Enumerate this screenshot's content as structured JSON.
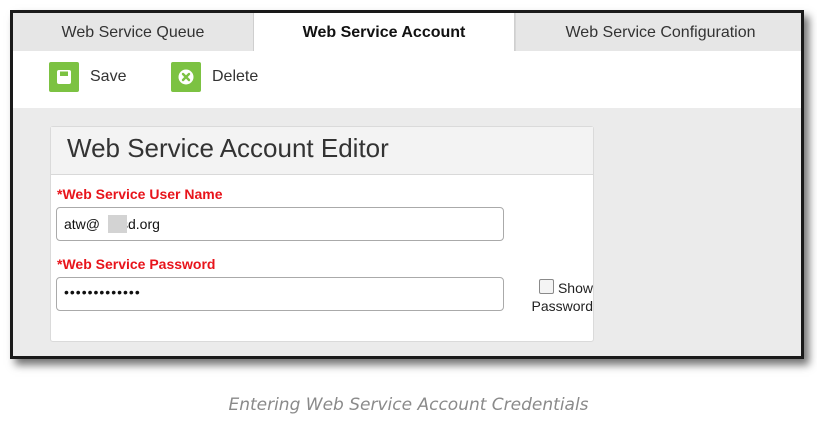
{
  "tabs": {
    "queue": "Web Service Queue",
    "account": "Web Service Account",
    "configuration": "Web Service Configuration"
  },
  "toolbar": {
    "save_label": "Save",
    "delete_label": "Delete",
    "accent_color": "#7cc242"
  },
  "editor": {
    "title": "Web Service Account Editor",
    "username_label": "*Web Service User Name",
    "username_value_prefix": "atw@",
    "username_value_suffix": "sd.org",
    "password_label": "*Web Service Password",
    "password_value": "•••••••••••••",
    "show_password_line1": "Show",
    "show_password_line2": "Password",
    "label_color": "#e8141b"
  },
  "caption": "Entering Web Service Account Credentials"
}
